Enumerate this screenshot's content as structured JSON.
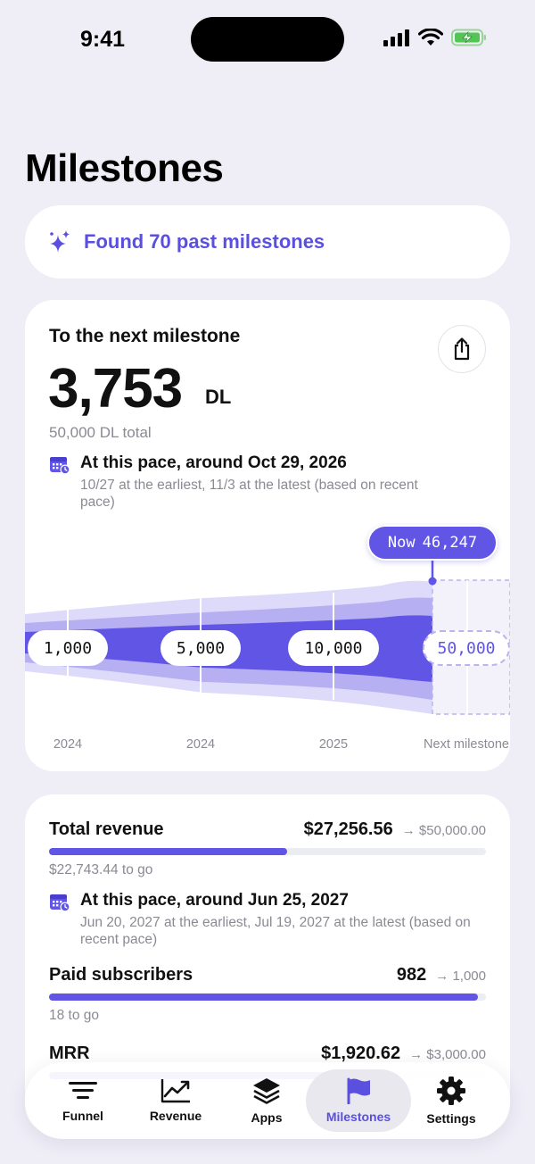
{
  "status": {
    "time": "9:41"
  },
  "page": {
    "title": "Milestones"
  },
  "found": {
    "text": "Found 70 past milestones"
  },
  "next_milestone": {
    "heading": "To the next milestone",
    "remaining": "3,753",
    "unit": "DL",
    "total": "50,000 DL total",
    "pace_main": "At this pace, around Oct 29, 2026",
    "pace_detail": "10/27 at the earliest, 11/3 at the latest (based on recent pace)",
    "now_label": "Now",
    "now_value": "46,247",
    "milestones": [
      "1,000",
      "5,000",
      "10,000",
      "50,000"
    ],
    "axis_labels": [
      "2024",
      "2024",
      "2025",
      "Next milestone"
    ]
  },
  "metrics": [
    {
      "label": "Total revenue",
      "current": "$27,256.56",
      "target": "→ $50,000.00",
      "progress": 0.545,
      "to_go": "$22,743.44 to go",
      "pace_main": "At this pace, around Jun 25, 2027",
      "pace_detail": "Jun 20, 2027 at the earliest, Jul 19, 2027 at the latest (based on recent pace)"
    },
    {
      "label": "Paid subscribers",
      "current": "982",
      "target": "→ 1,000",
      "progress": 0.982,
      "to_go": "18 to go"
    },
    {
      "label": "MRR",
      "current": "$1,920.62",
      "target": "→ $3,000.00",
      "progress": 0.64
    }
  ],
  "tabs": [
    {
      "label": "Funnel",
      "icon": "funnel-icon"
    },
    {
      "label": "Revenue",
      "icon": "chart-line-icon"
    },
    {
      "label": "Apps",
      "icon": "layers-icon"
    },
    {
      "label": "Milestones",
      "icon": "flag-icon"
    },
    {
      "label": "Settings",
      "icon": "gear-icon"
    }
  ],
  "colors": {
    "accent": "#6155e6",
    "background": "#efeef7"
  }
}
